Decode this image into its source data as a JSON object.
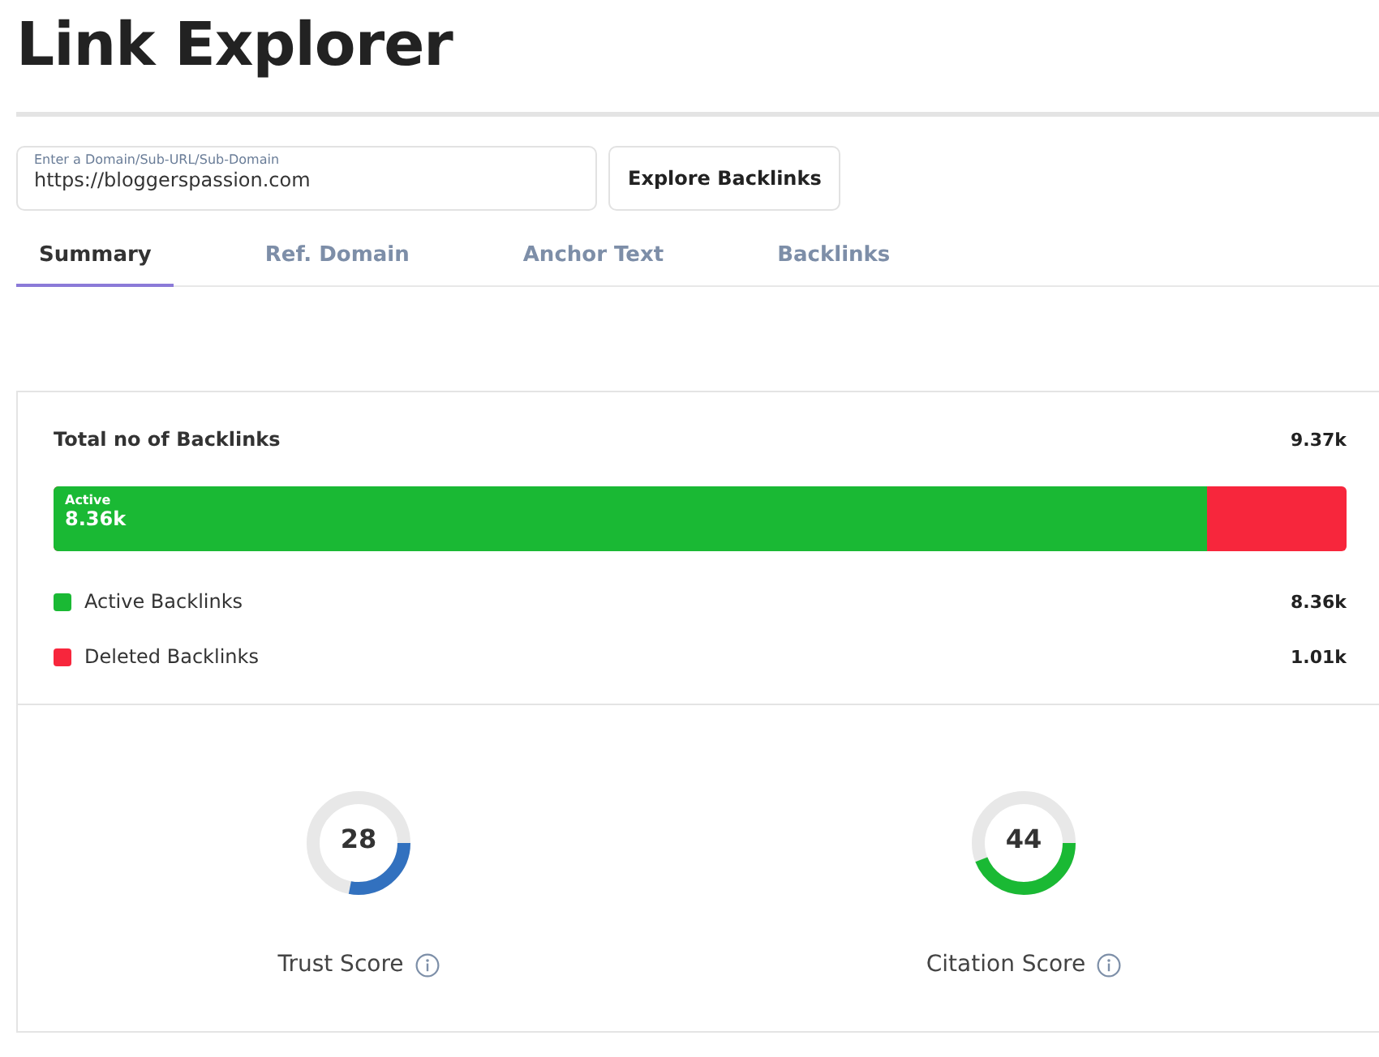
{
  "page_title": "Link Explorer",
  "search": {
    "placeholder": "Enter a Domain/Sub-URL/Sub-Domain",
    "value": "https://bloggerspassion.com",
    "button": "Explore Backlinks"
  },
  "tabs": [
    {
      "label": "Summary",
      "selected": true
    },
    {
      "label": "Ref. Domain",
      "selected": false
    },
    {
      "label": "Anchor Text",
      "selected": false
    },
    {
      "label": "Backlinks",
      "selected": false
    }
  ],
  "summary": {
    "label": "Total no of Backlinks",
    "value": "9.37k",
    "bar": {
      "level": 0.892,
      "label": "Active",
      "value": "8.36k"
    },
    "legend": [
      {
        "label": "Active Backlinks",
        "value": "8.36k",
        "color": "#1ab934"
      },
      {
        "label": "Deleted Backlinks",
        "value": "1.01k",
        "color": "#f7263c"
      }
    ]
  },
  "scores": [
    {
      "value": "28",
      "label": "Trust Score",
      "level": 0.28,
      "color": "#3271bf"
    },
    {
      "value": "44",
      "label": "Citation Score",
      "level": 0.44,
      "color": "#1ab934"
    }
  ]
}
